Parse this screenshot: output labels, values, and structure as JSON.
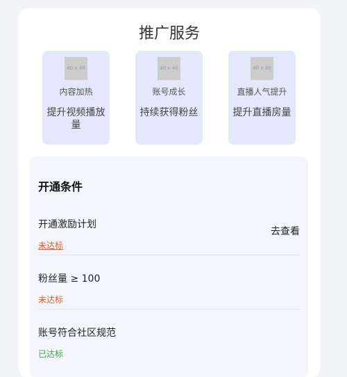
{
  "page": {
    "title": "推广服务"
  },
  "services": [
    {
      "thumb": "40 x 40",
      "name": "内容加热",
      "desc": "提升视频播放量"
    },
    {
      "thumb": "40 x 40",
      "name": "账号成长",
      "desc": "持续获得粉丝"
    },
    {
      "thumb": "40 x 40",
      "name": "直播人气提升",
      "desc": "提升直播房量"
    }
  ],
  "conditions": {
    "title": "开通条件",
    "action_label": "去查看",
    "items": [
      {
        "label": "开通激励计划",
        "status": "未达标"
      },
      {
        "label": "粉丝量 ≥ 100",
        "status": "未达标"
      },
      {
        "label": "账号符合社区规范",
        "status": "已达标"
      }
    ]
  },
  "colors": {
    "card_bg": "#e3e9fb",
    "status_unmet": "#e4572e",
    "status_met": "#3aa84a"
  }
}
